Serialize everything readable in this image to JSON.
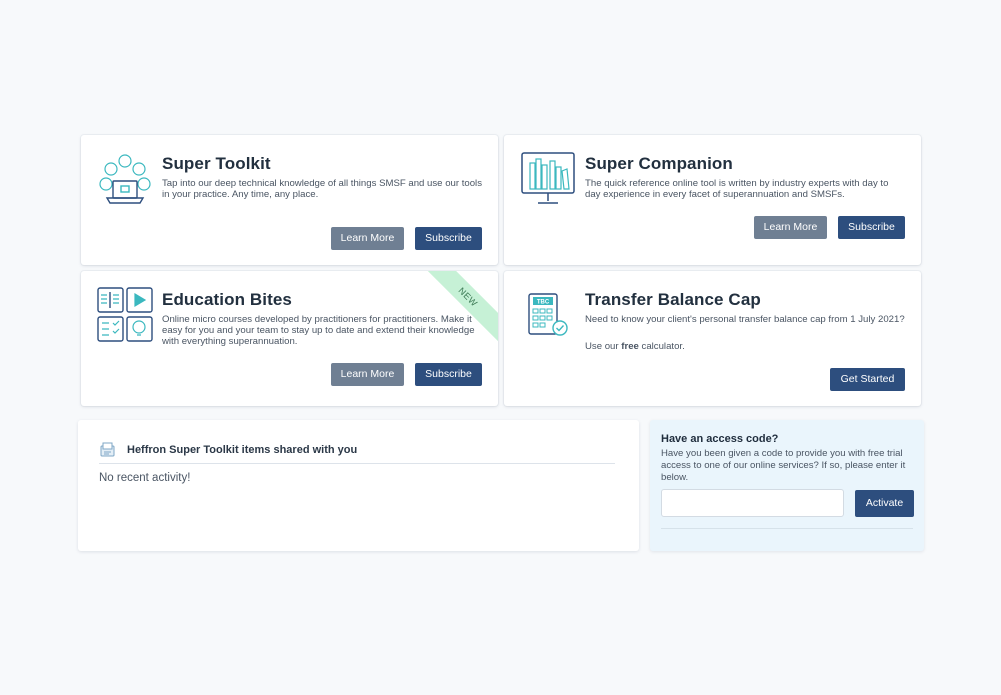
{
  "cards": {
    "toolkit": {
      "title": "Super Toolkit",
      "description": "Tap into our deep technical knowledge of all things SMSF and use our tools in your practice. Any time, any place.",
      "icon": "laptop-network-icon",
      "learn_more": "Learn More",
      "subscribe": "Subscribe"
    },
    "companion": {
      "title": "Super Companion",
      "description": "The quick reference online tool is written by industry experts with day to day experience in every facet of superannuation and SMSFs.",
      "icon": "monitor-books-icon",
      "learn_more": "Learn More",
      "subscribe": "Subscribe"
    },
    "education": {
      "title": "Education Bites",
      "description": "Online micro courses developed by practitioners for practitioners. Make it easy for you and your team to stay up to date and extend their knowledge with everything superannuation.",
      "icon": "education-grid-icon",
      "badge": "NEW",
      "learn_more": "Learn More",
      "subscribe": "Subscribe"
    },
    "tbc": {
      "title": "Transfer Balance Cap",
      "description": "Need to know your client's personal transfer balance cap from 1 July 2021?",
      "note_prefix": "Use our ",
      "note_bold": "free",
      "note_suffix": " calculator.",
      "icon": "tbc-calculator-icon",
      "icon_label": "TBC",
      "get_started": "Get Started"
    }
  },
  "activity": {
    "title": "Heffron Super Toolkit items shared with you",
    "empty": "No recent activity!",
    "icon": "shared-items-icon"
  },
  "access": {
    "title": "Have an access code?",
    "description": "Have you been given a code to provide you with free trial access to one of our online services? If so, please enter it below.",
    "input_value": "",
    "input_placeholder": "",
    "activate": "Activate"
  },
  "colors": {
    "navy": "#2d4e7e",
    "grey_button": "#6f7f93",
    "teal_icon": "#3bb8bf",
    "ribbon": "#c6f1d6"
  }
}
